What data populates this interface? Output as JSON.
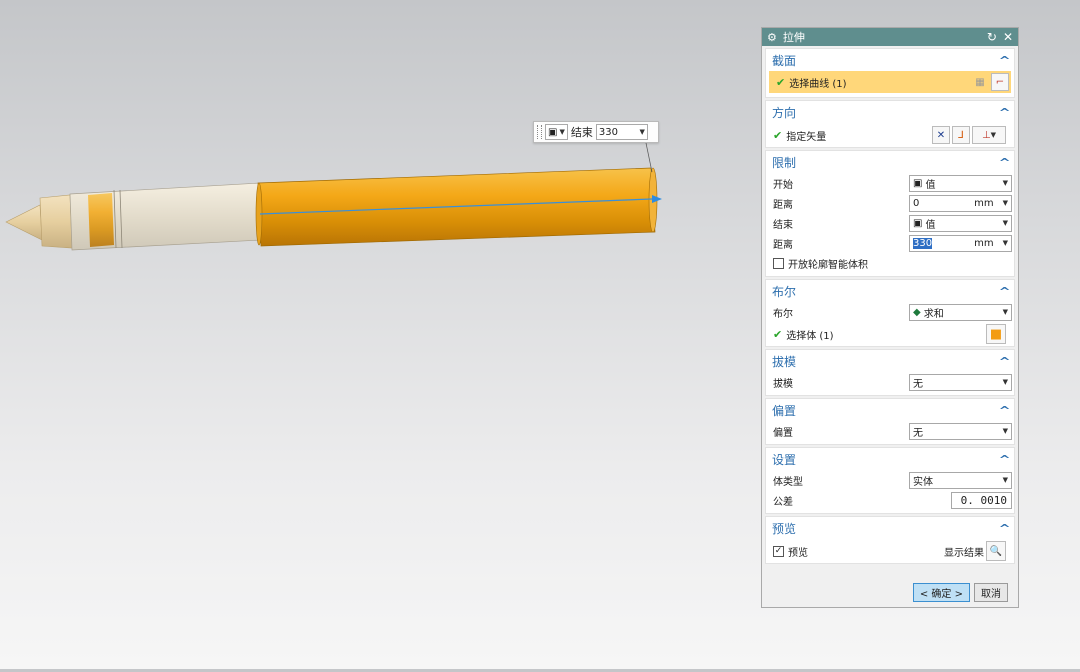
{
  "float_tool": {
    "label": "结束",
    "value": "330"
  },
  "dialog": {
    "title": "拉伸",
    "sections": {
      "section": {
        "title": "截面",
        "select_curve": "选择曲线 (1)"
      },
      "direction": {
        "title": "方向",
        "vector": "指定矢量"
      },
      "limits": {
        "title": "限制",
        "start_label": "开始",
        "start_value": "值",
        "dist1_label": "距离",
        "dist1_value": "0",
        "dist1_unit": "mm",
        "end_label": "结束",
        "end_value": "值",
        "dist2_label": "距离",
        "dist2_value": "330",
        "dist2_unit": "mm",
        "open_profile": "开放轮廓智能体积"
      },
      "boolean": {
        "title": "布尔",
        "label": "布尔",
        "value": "求和",
        "select_body": "选择体 (1)"
      },
      "draft": {
        "title": "拔模",
        "label": "拔模",
        "value": "无"
      },
      "offset": {
        "title": "偏置",
        "label": "偏置",
        "value": "无"
      },
      "settings": {
        "title": "设置",
        "body_type_label": "体类型",
        "body_type_value": "实体",
        "tolerance_label": "公差",
        "tolerance_value": "0. 0010"
      },
      "preview": {
        "title": "预览",
        "preview_label": "预览",
        "show_result": "显示结果"
      }
    },
    "ok_label": "< 确定 >",
    "cancel_label": "取消"
  }
}
